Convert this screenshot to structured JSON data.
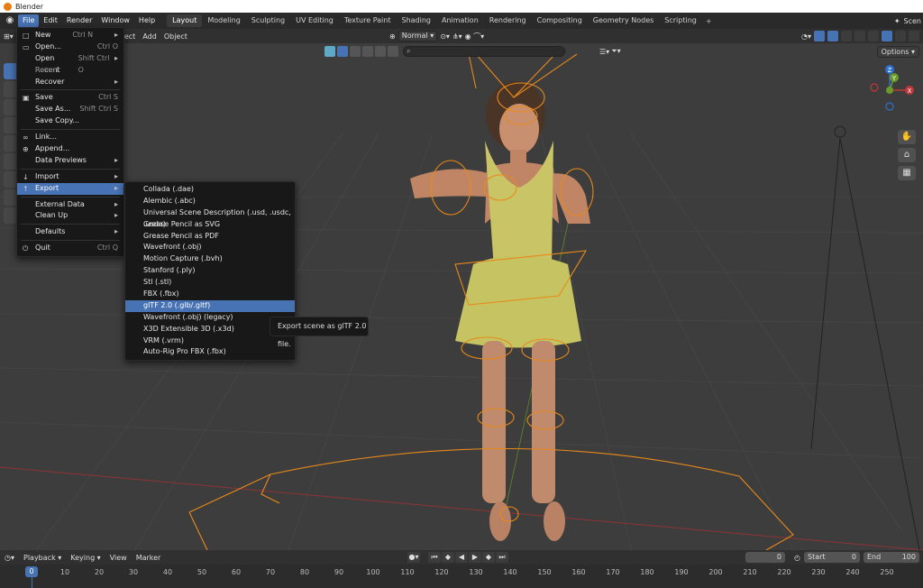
{
  "window": {
    "title": "Blender"
  },
  "menubar": {
    "items": [
      "File",
      "Edit",
      "Render",
      "Window",
      "Help"
    ],
    "active": "File",
    "tabs": [
      "Layout",
      "Modeling",
      "Sculpting",
      "UV Editing",
      "Texture Paint",
      "Shading",
      "Animation",
      "Rendering",
      "Compositing",
      "Geometry Nodes",
      "Scripting"
    ],
    "active_tab": "Layout",
    "scene_label": "Scen"
  },
  "viewport_header": {
    "select_label": "elect",
    "add_label": "Add",
    "object_label": "Object",
    "orientation": "Normal"
  },
  "viewport": {
    "options_label": "Options"
  },
  "file_menu": {
    "items": [
      {
        "label": "New",
        "shortcut": "Ctrl N",
        "submenu": true,
        "icon": "new-file-icon"
      },
      {
        "label": "Open...",
        "shortcut": "Ctrl O",
        "icon": "folder-icon"
      },
      {
        "label": "Open Recent",
        "shortcut": "Shift Ctrl O",
        "submenu": true
      },
      {
        "label": "Revert",
        "disabled": true
      },
      {
        "label": "Recover",
        "submenu": true
      },
      {
        "label": "Save",
        "shortcut": "Ctrl S",
        "icon": "save-icon"
      },
      {
        "label": "Save As...",
        "shortcut": "Shift Ctrl S"
      },
      {
        "label": "Save Copy..."
      },
      {
        "label": "Link...",
        "icon": "link-icon"
      },
      {
        "label": "Append...",
        "icon": "append-icon"
      },
      {
        "label": "Data Previews",
        "submenu": true
      },
      {
        "label": "Import",
        "submenu": true,
        "icon": "import-icon"
      },
      {
        "label": "Export",
        "submenu": true,
        "icon": "export-icon",
        "highlight": true
      },
      {
        "label": "External Data",
        "submenu": true
      },
      {
        "label": "Clean Up",
        "submenu": true
      },
      {
        "label": "Defaults",
        "submenu": true
      },
      {
        "label": "Quit",
        "shortcut": "Ctrl Q",
        "icon": "quit-icon"
      }
    ]
  },
  "export_menu": {
    "items": [
      "Collada (.dae)",
      "Alembic (.abc)",
      "Universal Scene Description (.usd, .usdc, .usda)",
      "Grease Pencil as SVG",
      "Grease Pencil as PDF",
      "Wavefront (.obj)",
      "Motion Capture (.bvh)",
      "Stanford (.ply)",
      "Stl (.stl)",
      "FBX (.fbx)",
      "glTF 2.0 (.glb/.gltf)",
      "Wavefront (.obj) (legacy)",
      "X3D Extensible 3D (.x3d)",
      "VRM (.vrm)",
      "Auto-Rig Pro FBX (.fbx)"
    ],
    "highlighted": "glTF 2.0 (.glb/.gltf)"
  },
  "tooltip": {
    "text": "Export scene as glTF 2.0 file."
  },
  "timeline": {
    "menu": [
      "Playback",
      "Keying",
      "View",
      "Marker"
    ],
    "current_frame": "0",
    "frame_field": "0",
    "start_label": "Start",
    "start_value": "0",
    "end_label": "End",
    "end_value": "100",
    "ticks": [
      "0",
      "10",
      "20",
      "30",
      "40",
      "50",
      "60",
      "70",
      "80",
      "90",
      "100",
      "110",
      "120",
      "130",
      "140",
      "150",
      "160",
      "170",
      "180",
      "190",
      "200",
      "210",
      "220",
      "230",
      "240",
      "250"
    ]
  },
  "gizmo": {
    "x": "X",
    "y": "Y",
    "z": "Z"
  },
  "colors": {
    "accent": "#4772b3",
    "rig": "#e8891a",
    "axis_x": "#c1363a",
    "axis_y": "#6a9a2a",
    "axis_z": "#2f6fcc"
  }
}
